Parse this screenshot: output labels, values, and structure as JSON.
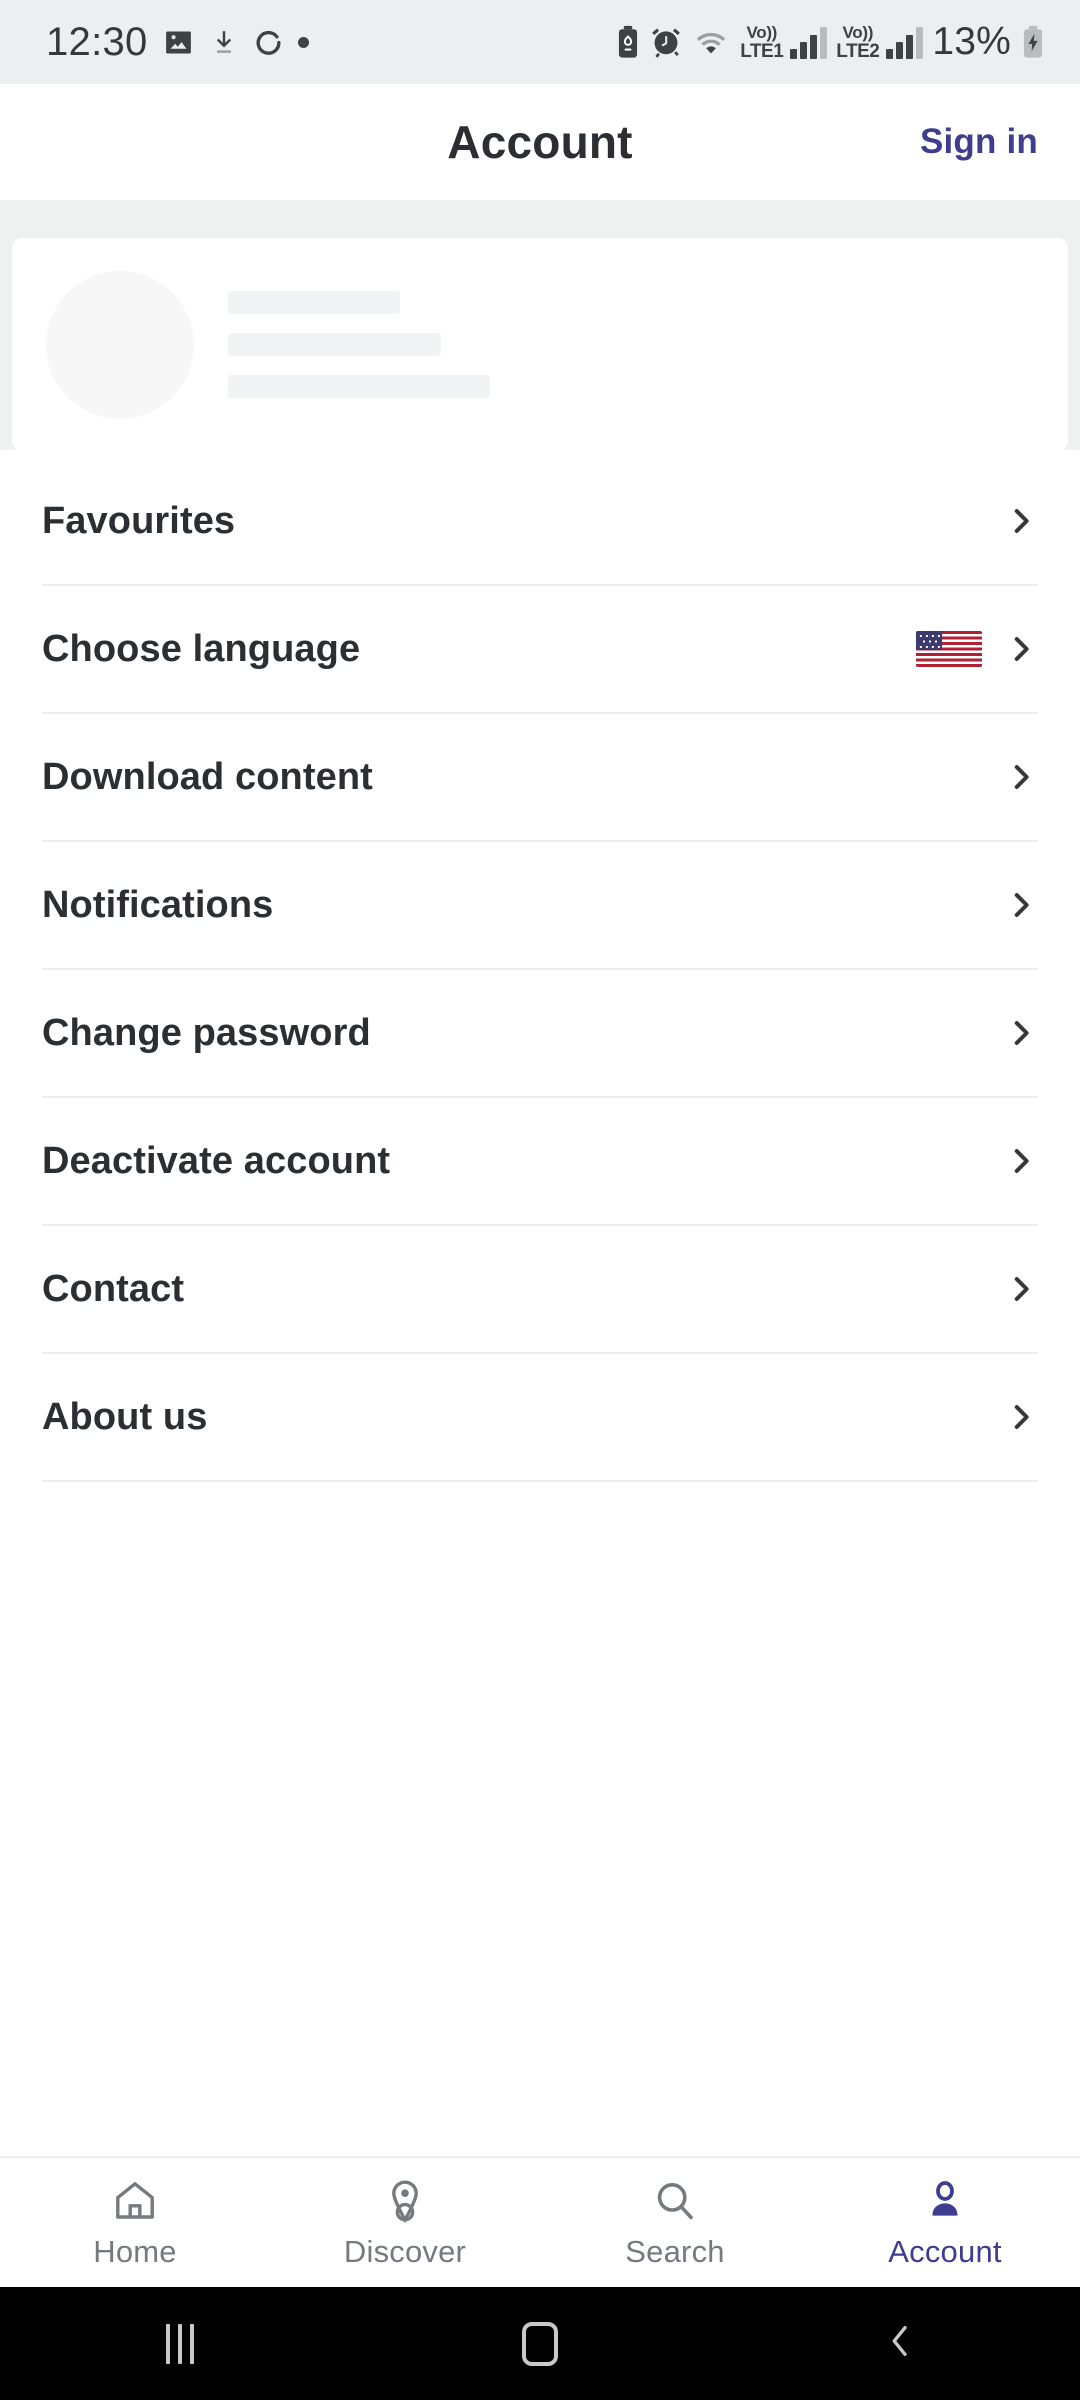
{
  "statusbar": {
    "time": "12:30",
    "battery_percent": "13%",
    "left_icons": [
      "image-icon",
      "download-icon",
      "sync-icon",
      "dot-indicator"
    ],
    "right_icons": [
      "battery-saver-icon",
      "alarm-icon",
      "wifi-icon",
      "signal-sim1-icon",
      "signal-sim2-icon",
      "charging-battery-icon"
    ],
    "sim1_label": "LTE1",
    "sim2_label": "LTE2",
    "volte_label": "Vo))",
    "background": "#eceff0"
  },
  "header": {
    "title": "Account",
    "sign_in_label": "Sign in",
    "accent": "#3f3d8f"
  },
  "profile_skeleton": {
    "is_loading": true,
    "avatar_shape": "circle",
    "placeholder_bars": 3
  },
  "menu": {
    "items": [
      {
        "label": "Favourites",
        "name": "favourites",
        "trailing": "chevron"
      },
      {
        "label": "Choose language",
        "name": "choose-language",
        "trailing": "flag-chevron",
        "flag": "us-flag"
      },
      {
        "label": "Download content",
        "name": "download-content",
        "trailing": "chevron"
      },
      {
        "label": "Notifications",
        "name": "notifications",
        "trailing": "chevron"
      },
      {
        "label": "Change password",
        "name": "change-password",
        "trailing": "chevron"
      },
      {
        "label": "Deactivate account",
        "name": "deactivate-account",
        "trailing": "chevron"
      },
      {
        "label": "Contact",
        "name": "contact",
        "trailing": "chevron"
      },
      {
        "label": "About us",
        "name": "about-us",
        "trailing": "chevron"
      }
    ]
  },
  "bottom_nav": {
    "active": "Account",
    "active_color": "#3f3d8f",
    "inactive_color": "#767a7e",
    "items": [
      {
        "label": "Home",
        "icon": "home-icon",
        "active": false
      },
      {
        "label": "Discover",
        "icon": "location-pin-icon",
        "active": false
      },
      {
        "label": "Search",
        "icon": "search-icon",
        "active": false
      },
      {
        "label": "Account",
        "icon": "person-icon",
        "active": true
      }
    ]
  },
  "system_nav": {
    "buttons": [
      "recent-apps-icon",
      "home-icon",
      "back-icon"
    ]
  }
}
